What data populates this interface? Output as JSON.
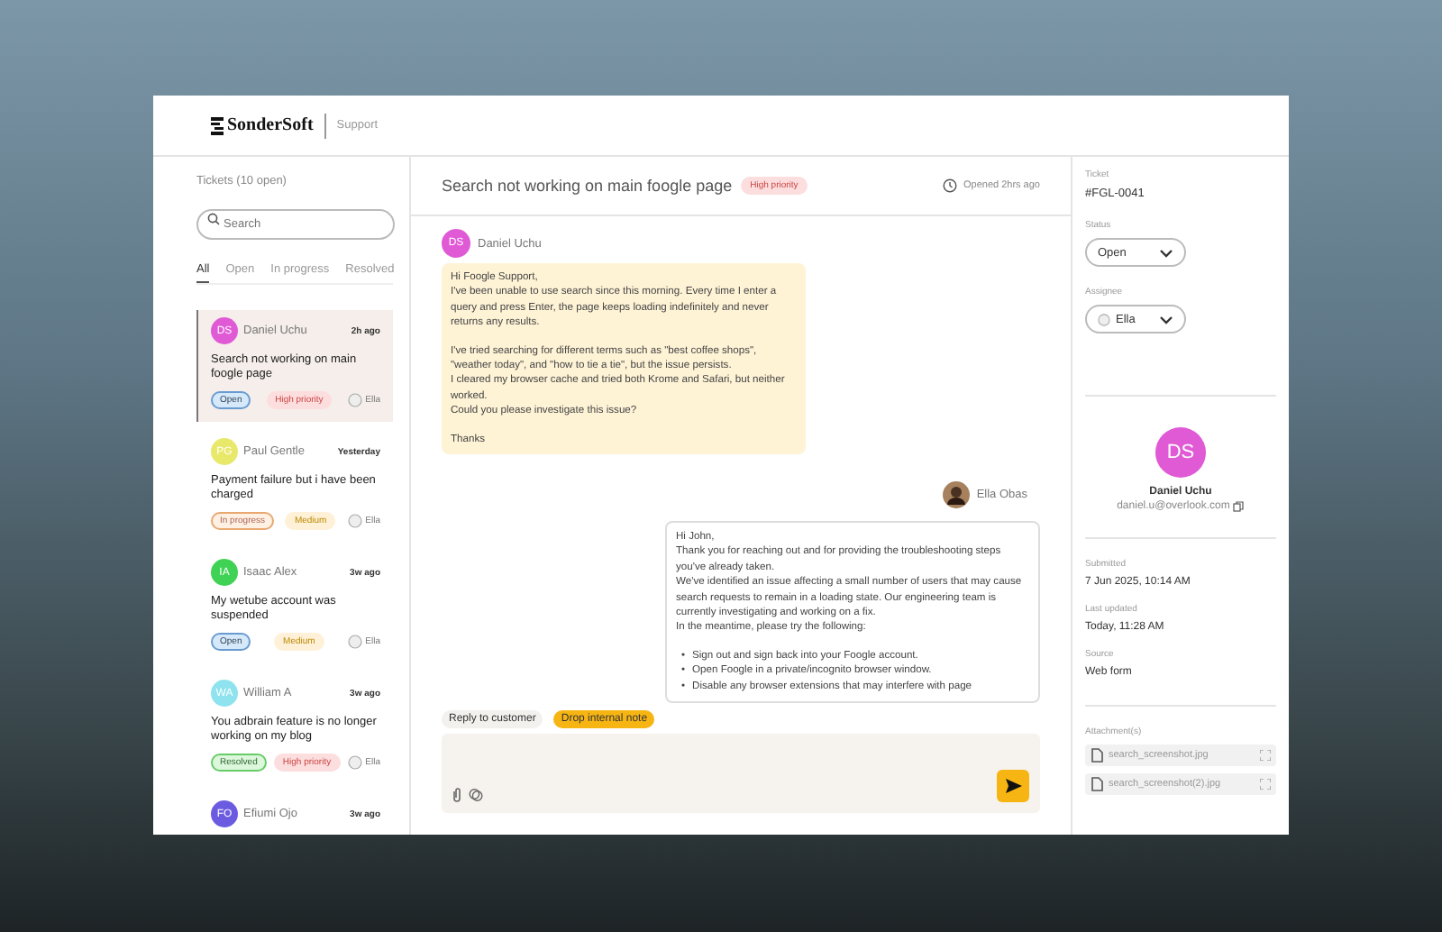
{
  "header": {
    "brand": "SonderSoft",
    "section": "Support"
  },
  "sidebar": {
    "heading": "Tickets (10 open)",
    "search": {
      "placeholder": "Search"
    },
    "tabs": [
      {
        "label": "All",
        "selected": true
      },
      {
        "label": "Open",
        "selected": false
      },
      {
        "label": "In progress",
        "selected": false
      },
      {
        "label": "Resolved",
        "selected": false
      }
    ],
    "tickets": [
      {
        "initials": "DS",
        "color": "#e05ad6",
        "name": "Daniel Uchu",
        "time": "2h ago",
        "title": "Search not working on main foogle page",
        "status": {
          "kind": "open",
          "label": "Open"
        },
        "priority": {
          "kind": "high",
          "label": "High priority"
        },
        "assignee": "Ella",
        "selected": true
      },
      {
        "initials": "PG",
        "color": "#e8e86a",
        "name": "Paul Gentle",
        "time": "Yesterday",
        "title": "Payment failure but i have been charged",
        "status": {
          "kind": "in_progress",
          "label": "In progress"
        },
        "priority": {
          "kind": "medium",
          "label": "Medium"
        },
        "assignee": "Ella",
        "selected": false
      },
      {
        "initials": "IA",
        "color": "#3fd255",
        "name": "Isaac Alex",
        "time": "3w ago",
        "title": "My wetube account was suspended",
        "status": {
          "kind": "open",
          "label": "Open"
        },
        "priority": {
          "kind": "medium",
          "label": "Medium"
        },
        "assignee": "Ella",
        "selected": false
      },
      {
        "initials": "WA",
        "color": "#8ee3ee",
        "name": "William A",
        "time": "3w ago",
        "title": "You adbrain feature is no longer working on my blog",
        "status": {
          "kind": "resolved",
          "label": "Resolved"
        },
        "priority": {
          "kind": "high",
          "label": "High priority"
        },
        "assignee": "Ella",
        "selected": false
      },
      {
        "initials": "FO",
        "color": "#6b5be0",
        "name": "Efiumi Ojo",
        "time": "3w ago",
        "selected": false
      }
    ]
  },
  "conversation": {
    "title": "Search not working on main foogle page",
    "priority": "High priority",
    "opened": "Opened 2hrs ago",
    "messages": [
      {
        "kind": "customer",
        "author": "Daniel Uchu",
        "initials": "DS",
        "color": "#e05ad6",
        "paragraphs": [
          "Hi Foogle Support,\nI've been unable to use search since this morning. Every time I enter a query and press Enter, the page keeps loading indefinitely and never returns any results.",
          "I've tried searching for different terms such as \"best coffee shops\", \"weather today\", and \"how to tie a tie\", but the issue persists.\nI cleared my browser cache and tried both Krome and Safari, but neither worked.\nCould you please investigate this issue?",
          "Thanks"
        ]
      },
      {
        "kind": "agent",
        "author": "Ella Obas",
        "bullet_marker": "•",
        "paragraphs": [
          "Hi John,\nThank you for reaching out and for providing the troubleshooting steps you've already taken.\nWe've identified an issue affecting a small number of users that may cause search requests to remain in a loading state. Our engineering team is currently investigating and working on a fix.\nIn the meantime, please try the following:"
        ],
        "bullets": [
          "Sign out and sign back into your Foogle account.",
          "Open Foogle in a private/incognito browser window.",
          "Disable any browser extensions that may interfere with page"
        ]
      }
    ],
    "composer": {
      "modes": [
        {
          "label": "Reply to customer",
          "selected": false
        },
        {
          "label": "Drop internal note",
          "selected": true
        }
      ]
    }
  },
  "details": {
    "ticket_label": "Ticket",
    "ticket_id": "#FGL-0041",
    "status_label": "Status",
    "status": "Open",
    "assignee_label": "Assignee",
    "assignee": "Ella",
    "customer": {
      "initials": "DS",
      "color": "#e05ad6",
      "name": "Daniel Uchu",
      "email": "daniel.u@overlook.com"
    },
    "fields": [
      {
        "label": "Submitted",
        "value": "7 Jun 2025, 10:14 AM"
      },
      {
        "label": "Last updated",
        "value": "Today, 11:28 AM"
      },
      {
        "label": "Source",
        "value": "Web form"
      }
    ],
    "attachments_label": "Attachment(s)",
    "attachments": [
      "search_screenshot.jpg",
      "search_screenshot(2).jpg"
    ]
  }
}
